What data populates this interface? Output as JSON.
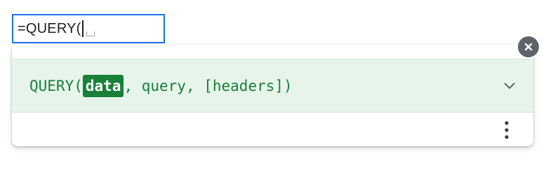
{
  "cell_editor": {
    "formula_text": "=QUERY("
  },
  "formula_help": {
    "function_name": "QUERY(",
    "active_argument": "data",
    "remaining_arguments": ", query, [headers])",
    "colors": {
      "signature_text": "#188038",
      "highlight_background": "#188038",
      "row_background": "#e6f4ea"
    },
    "icons": {
      "expand": "chevron-down-icon",
      "more": "more-vert-icon",
      "close": "close-icon"
    }
  }
}
